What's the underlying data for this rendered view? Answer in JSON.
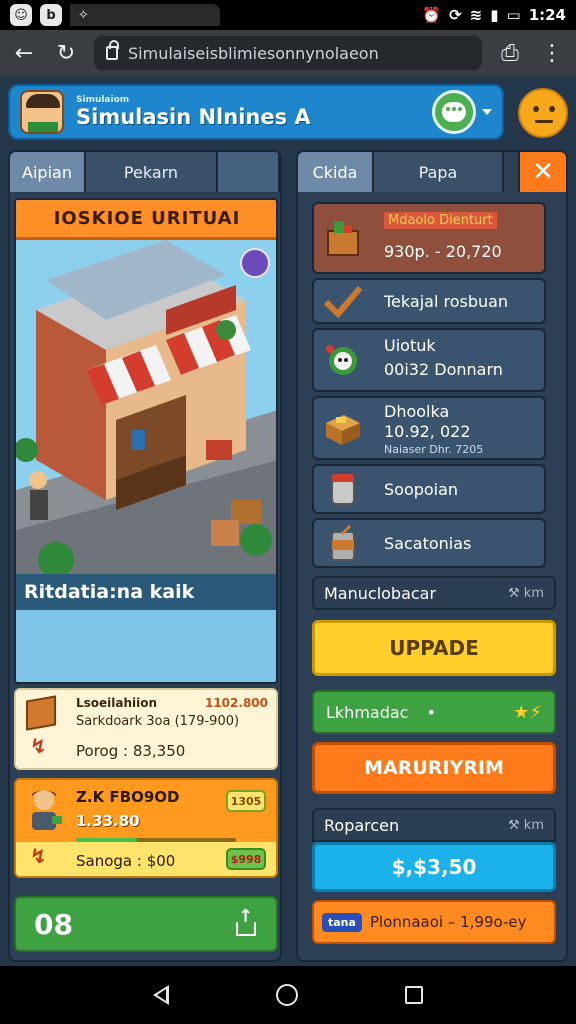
{
  "statusbar": {
    "time": "1:24",
    "icons": [
      "face-icon",
      "b-icon",
      "app-icon",
      "alarm-icon",
      "sync-icon",
      "wifi-icon",
      "signal-icon",
      "battery-icon"
    ]
  },
  "browser": {
    "url": "Simulaiseisblimiesonnynolaeon"
  },
  "header": {
    "subtitle": "Simulaiom",
    "title": "Simulasin Nlnines A"
  },
  "left_panel": {
    "tabs": [
      "Aipian",
      "Pekarn",
      ""
    ],
    "shop_banner": "IOSKIOE URITUAI",
    "shop_footer": "Ritdatia:na kaik",
    "card1": {
      "title": "Lsoeilahiion",
      "price": "1102.800",
      "detail": "Sarkdoark 3oa (179-900)",
      "bottom": "Porog : 83,350"
    },
    "card2": {
      "title": "Z.K FBO9OD",
      "value": "1.33.80",
      "pill_top": "1305",
      "progress_pct": 38,
      "bottom": "Sanoga : $00",
      "pill_bottom": "$998"
    },
    "bottom_value": "08"
  },
  "right_panel": {
    "tabs": [
      "Ckida",
      "Papa"
    ],
    "close_symbol": "✕",
    "items": [
      {
        "title": "Mdaolo Dienturt",
        "sub": "930p. - 20,720"
      },
      {
        "title": "Tekajal rosbuan"
      },
      {
        "title": "Uiotuk",
        "sub": "00i32 Donnarn"
      },
      {
        "title": "Dhoolka",
        "sub": "10.92, 022",
        "tiny": "Naiaser Dhr. 7205"
      },
      {
        "title": "Soopoian"
      },
      {
        "title": "Sacatonias"
      }
    ],
    "manual_row": {
      "label": "Manuclobacar",
      "right": "⚒ km"
    },
    "upgrade_button": "UPPADE",
    "green_row": {
      "label": "Lkhmadac",
      "dot": "•",
      "right": "★⚡"
    },
    "orange_button": "MARURIYRIM",
    "rapport_row": {
      "label": "Roparcen",
      "right": "⚒ km"
    },
    "cyan_button": "$,$3,50",
    "promo": {
      "tag": "tana",
      "text": "Plonnaaoi – 1,99o-ey"
    }
  },
  "colors": {
    "accent_blue": "#1e86cc",
    "orange": "#ff7a1a",
    "yellow": "#ffd02c",
    "green": "#3fa242",
    "cyan": "#1bb1ea",
    "panel": "#2c3f55"
  }
}
